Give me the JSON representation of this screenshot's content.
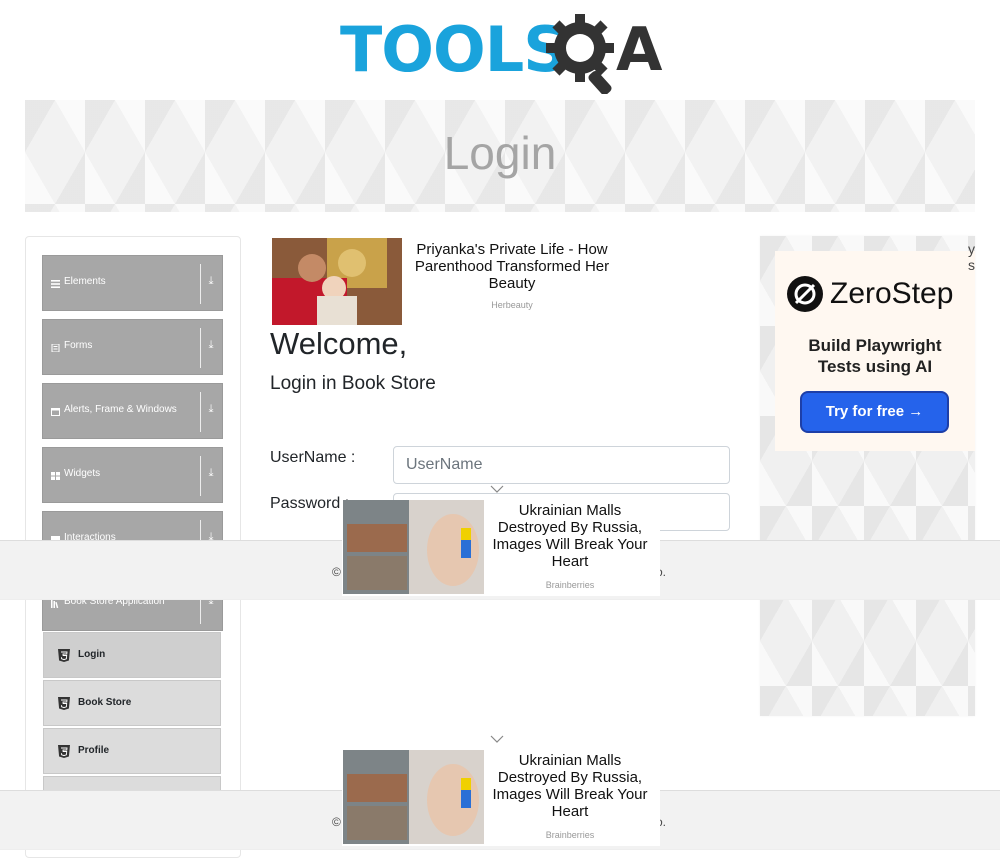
{
  "logo": {
    "text": "TOOLS",
    "suffix": "A"
  },
  "banner": {
    "title": "Login"
  },
  "sidebar": {
    "groups": [
      {
        "label": "Elements",
        "icon": "list-icon"
      },
      {
        "label": "Forms",
        "icon": "form-icon"
      },
      {
        "label": "Alerts, Frame & Windows",
        "icon": "window-icon"
      },
      {
        "label": "Widgets",
        "icon": "grid-icon"
      },
      {
        "label": "Interactions",
        "icon": "interaction-icon"
      },
      {
        "label": "Book Store Application",
        "icon": "book-icon"
      }
    ],
    "book_store_items": [
      {
        "label": "Login",
        "active": true
      },
      {
        "label": "Book Store",
        "active": false
      },
      {
        "label": "Profile",
        "active": false
      }
    ]
  },
  "ad_top": {
    "title": "Priyanka's Private Life - How Parenthood Transformed Her Beauty",
    "source": "Herbeauty"
  },
  "main": {
    "welcome": "Welcome,",
    "subtitle": "Login in Book Store",
    "username_label": "UserName :",
    "username_placeholder": "UserName",
    "password_label": "Password :"
  },
  "side_ad": {
    "brand": "ZeroStep",
    "tagline_1": "Build Playwright",
    "tagline_2": "Tests using AI",
    "cta": "Try for free →",
    "edge_text_1": "y",
    "edge_text_2": "s"
  },
  "footer": {
    "left": "©",
    "right": "o."
  },
  "popup_ad": {
    "title": "Ukrainian Malls Destroyed By Russia, Images Will Break Your Heart",
    "source": "Brainberries"
  },
  "colors": {
    "brand_blue": "#1aa3dc",
    "sidebar_gray": "#a7a7a7",
    "cta_blue": "#2563eb"
  }
}
